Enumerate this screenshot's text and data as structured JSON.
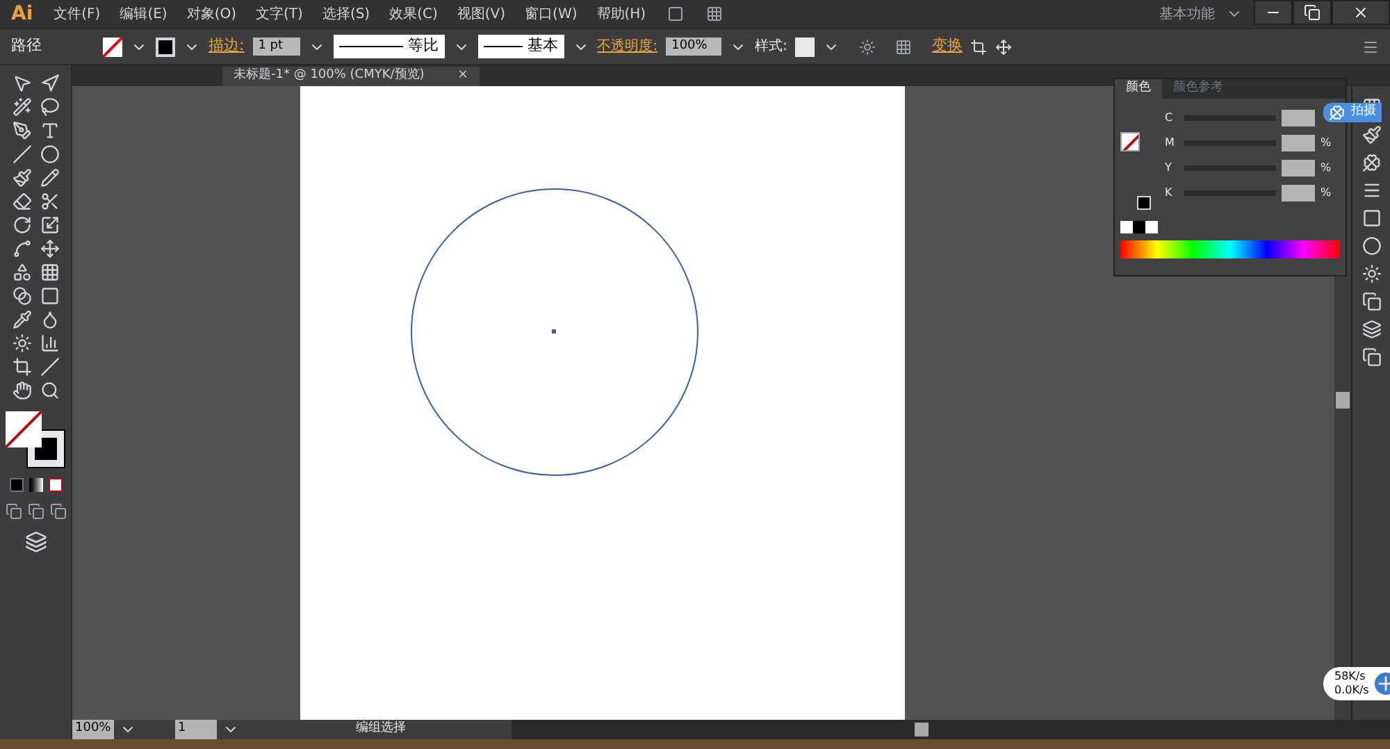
{
  "app": {
    "logo": "Ai",
    "workspace": "基本功能"
  },
  "menus": [
    "文件(F)",
    "编辑(E)",
    "对象(O)",
    "文字(T)",
    "选择(S)",
    "效果(C)",
    "视图(V)",
    "窗口(W)",
    "帮助(H)"
  ],
  "control_bar": {
    "selection": "路径",
    "stroke_label": "描边:",
    "stroke_weight": "1 pt",
    "profile": "等比",
    "brush": "基本",
    "opacity_label": "不透明度:",
    "opacity": "100%",
    "style_label": "样式:",
    "transform": "变换"
  },
  "document_tab": {
    "title": "未标题-1* @ 100% (CMYK/预览)",
    "close": "×"
  },
  "color_panel": {
    "tabs": [
      {
        "label": "颜色",
        "selected": true
      },
      {
        "label": "颜色参考",
        "selected": false
      }
    ],
    "channels": [
      {
        "name": "C"
      },
      {
        "name": "M",
        "unit": "%"
      },
      {
        "name": "Y",
        "unit": "%"
      },
      {
        "name": "K",
        "unit": "%"
      }
    ]
  },
  "floating_widget": {
    "label": "拍摄"
  },
  "network_widget": {
    "upload": "58K/s",
    "download": "0.0K/s"
  },
  "status_bar": {
    "zoom": "100%",
    "page": "1",
    "status": "编组选择"
  }
}
